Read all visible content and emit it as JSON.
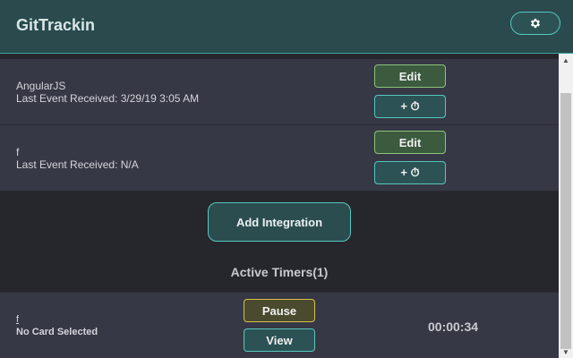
{
  "app": {
    "title": "GitTrackin"
  },
  "header": {
    "settings_icon": "gear-icon"
  },
  "integrations": [
    {
      "name": "AngularJS",
      "last_event": "Last Event Received: 3/29/19 3:05 AM",
      "edit_label": "Edit",
      "timer_label": "+ ⏱"
    },
    {
      "name": "f",
      "last_event": "Last Event Received: N/A",
      "edit_label": "Edit",
      "timer_label": "+ ⏱"
    }
  ],
  "add_integration_label": "Add Integration",
  "active_timers": {
    "heading": "Active Timers(1)",
    "items": [
      {
        "name": "f",
        "card": "No Card Selected",
        "pause_label": "Pause",
        "view_label": "View",
        "elapsed": "00:00:34"
      }
    ]
  },
  "colors": {
    "header_bg": "#2a4a4d",
    "accent": "#55c8be",
    "edit_border": "#8bc47a",
    "pause_border": "#d8c14a",
    "row_bg": "#363845",
    "page_bg": "#26262d"
  }
}
